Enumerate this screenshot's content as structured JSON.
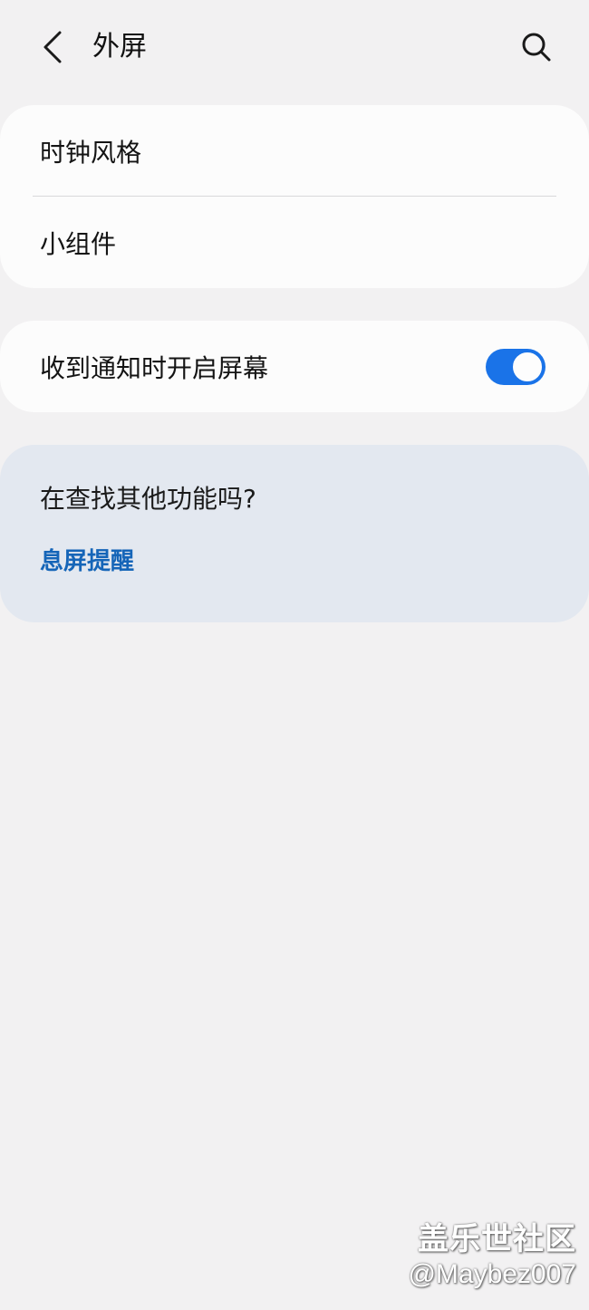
{
  "header": {
    "title": "外屏",
    "back_icon": "chevron-left-icon",
    "search_icon": "search-icon"
  },
  "settings_group": {
    "items": [
      {
        "label": "时钟风格"
      },
      {
        "label": "小组件"
      }
    ]
  },
  "notification_setting": {
    "label": "收到通知时开启屏幕",
    "toggle_on": true,
    "accent_color": "#1a73e8"
  },
  "suggestion": {
    "title": "在查找其他功能吗?",
    "link_label": "息屏提醒",
    "link_color": "#1565b8"
  },
  "watermark": {
    "line1": "盖乐世社区",
    "line2": "@Maybez007"
  }
}
